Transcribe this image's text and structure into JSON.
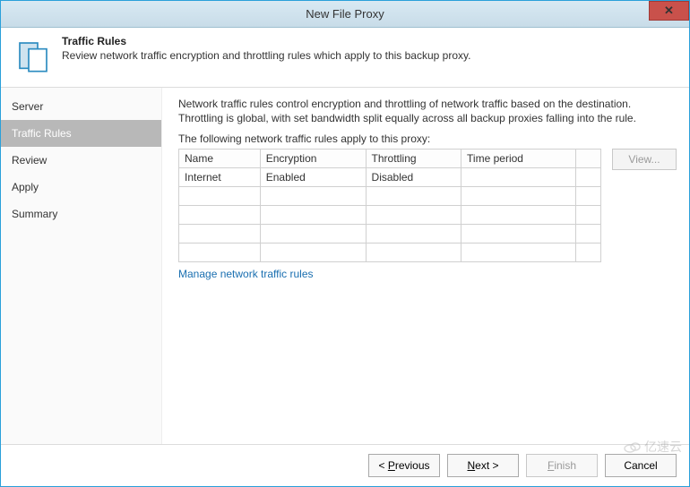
{
  "window": {
    "title": "New File Proxy",
    "close_glyph": "✕"
  },
  "header": {
    "title": "Traffic Rules",
    "subtitle": "Review network traffic encryption and throttling rules which apply to this backup proxy."
  },
  "sidebar": {
    "items": [
      {
        "label": "Server",
        "active": false
      },
      {
        "label": "Traffic Rules",
        "active": true
      },
      {
        "label": "Review",
        "active": false
      },
      {
        "label": "Apply",
        "active": false
      },
      {
        "label": "Summary",
        "active": false
      }
    ]
  },
  "main": {
    "description": "Network traffic rules control encryption and throttling of network traffic based on the destination. Throttling is global, with set bandwidth split equally across all backup proxies falling into the rule.",
    "table_label": "The following network traffic rules apply to this proxy:",
    "columns": [
      "Name",
      "Encryption",
      "Throttling",
      "Time period"
    ],
    "rows": [
      {
        "name": "Internet",
        "encryption": "Enabled",
        "throttling": "Disabled",
        "time_period": ""
      }
    ],
    "empty_row_count": 4,
    "view_button": "View...",
    "link": "Manage network traffic rules"
  },
  "footer": {
    "previous": "Previous",
    "next": "Next >",
    "finish": "Finish",
    "cancel": "Cancel"
  },
  "watermark": "亿速云"
}
